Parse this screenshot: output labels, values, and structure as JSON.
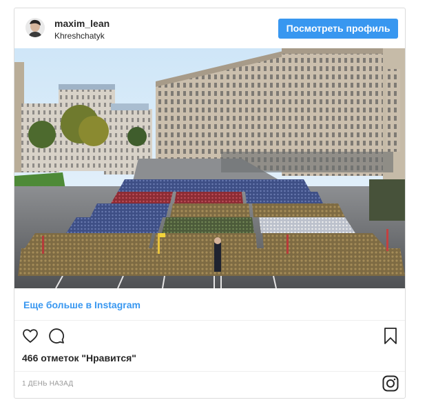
{
  "header": {
    "username": "maxim_lean",
    "location": "Khreshchatyk",
    "profile_button_label": "Посмотреть профиль"
  },
  "post": {
    "image_description": "military parade on Khreshchatyk street",
    "more_link_label": "Еще больше в Instagram",
    "likes_text": "466 отметок \"Нравится\"",
    "timestamp": "1 ДЕНЬ НАЗАД"
  },
  "icons": {
    "like": "heart-icon",
    "comment": "comment-icon",
    "save": "bookmark-icon",
    "brand": "instagram-icon"
  },
  "colors": {
    "accent": "#3897f0",
    "text": "#262626",
    "muted": "#999999",
    "border": "#dbdbdb"
  }
}
